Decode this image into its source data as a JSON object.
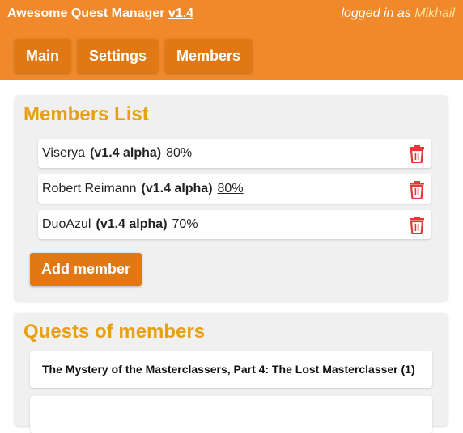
{
  "header": {
    "app_name": "Awesome Quest Manager",
    "version": "v1.4",
    "login_prefix": "logged in as",
    "username": "Mikhail"
  },
  "nav": {
    "items": [
      {
        "label": "Main"
      },
      {
        "label": "Settings"
      },
      {
        "label": "Members"
      }
    ]
  },
  "members_section": {
    "title": "Members List",
    "members": [
      {
        "name": "Viserya",
        "version": "(v1.4 alpha)",
        "progress": "80%"
      },
      {
        "name": "Robert Reimann",
        "version": "(v1.4 alpha)",
        "progress": "80%"
      },
      {
        "name": "DuoAzul",
        "version": "(v1.4 alpha)",
        "progress": "70%"
      }
    ],
    "add_button_label": "Add member",
    "delete_icon": "trash-icon",
    "delete_icon_color": "#e53935"
  },
  "quests_section": {
    "title": "Quests of members",
    "quests": [
      {
        "title": "The Mystery of the Masterclassers, Part 4: The Lost Masterclasser (1)"
      },
      {
        "title": ""
      }
    ]
  },
  "colors": {
    "header_bg": "#f0892b",
    "button_bg": "#e07914",
    "section_title": "#e8a013",
    "username": "#fde39a"
  }
}
